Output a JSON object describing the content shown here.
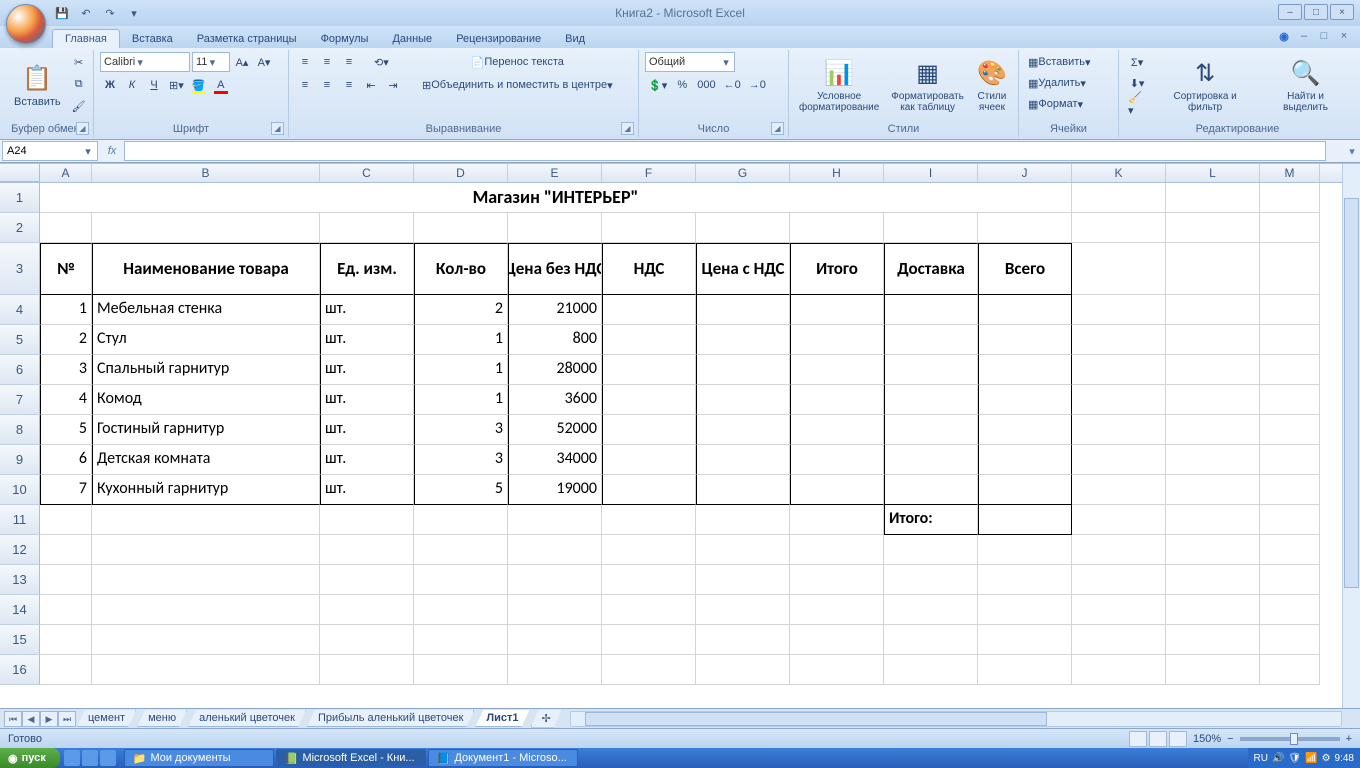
{
  "title": "Книга2 - Microsoft Excel",
  "tabs": [
    "Главная",
    "Вставка",
    "Разметка страницы",
    "Формулы",
    "Данные",
    "Рецензирование",
    "Вид"
  ],
  "ribbon": {
    "clipboard": {
      "paste": "Вставить",
      "label": "Буфер обмена"
    },
    "font": {
      "name": "Calibri",
      "size": "11",
      "label": "Шрифт",
      "bold": "Ж",
      "italic": "К",
      "underline": "Ч"
    },
    "align": {
      "wrap": "Перенос текста",
      "merge": "Объединить и поместить в центре",
      "label": "Выравнивание"
    },
    "number": {
      "format": "Общий",
      "label": "Число"
    },
    "styles": {
      "cond": "Условное форматирование",
      "table": "Форматировать как таблицу",
      "cell": "Стили ячеек",
      "label": "Стили"
    },
    "cells": {
      "insert": "Вставить",
      "delete": "Удалить",
      "format": "Формат",
      "label": "Ячейки"
    },
    "editing": {
      "sort": "Сортировка и фильтр",
      "find": "Найти и выделить",
      "label": "Редактирование"
    }
  },
  "namebox": "A24",
  "columns": [
    "A",
    "B",
    "C",
    "D",
    "E",
    "F",
    "G",
    "H",
    "I",
    "J",
    "K",
    "L",
    "M"
  ],
  "sheet": {
    "title": "Магазин \"ИНТЕРЬЕР\"",
    "headers": {
      "no": "№",
      "name": "Наименование товара",
      "unit": "Ед. изм.",
      "qty": "Кол-во",
      "price": "Цена без НДС",
      "vat": "НДС",
      "pricevat": "Цена с НДС",
      "total": "Итого",
      "delivery": "Доставка",
      "grand": "Всего"
    },
    "rows": [
      {
        "no": "1",
        "name": "Мебельная стенка",
        "unit": "шт.",
        "qty": "2",
        "price": "21000"
      },
      {
        "no": "2",
        "name": "Стул",
        "unit": "шт.",
        "qty": "1",
        "price": "800"
      },
      {
        "no": "3",
        "name": "Спальный гарнитур",
        "unit": "шт.",
        "qty": "1",
        "price": "28000"
      },
      {
        "no": "4",
        "name": "Комод",
        "unit": "шт.",
        "qty": "1",
        "price": "3600"
      },
      {
        "no": "5",
        "name": "Гостиный гарнитур",
        "unit": "шт.",
        "qty": "3",
        "price": "52000"
      },
      {
        "no": "6",
        "name": "Детская комната",
        "unit": "шт.",
        "qty": "3",
        "price": "34000"
      },
      {
        "no": "7",
        "name": "Кухонный гарнитур",
        "unit": "шт.",
        "qty": "5",
        "price": "19000"
      }
    ],
    "footer": "Итого:"
  },
  "sheettabs": [
    "цемент",
    "меню",
    "аленький цветочек",
    "Прибыль аленький цветочек",
    "Лист1"
  ],
  "status": {
    "ready": "Готово",
    "zoom": "150%"
  },
  "taskbar": {
    "start": "пуск",
    "buttons": [
      "Мои документы",
      "Microsoft Excel - Кни...",
      "Документ1 - Microso..."
    ],
    "lang": "RU",
    "clock": "9:48"
  }
}
